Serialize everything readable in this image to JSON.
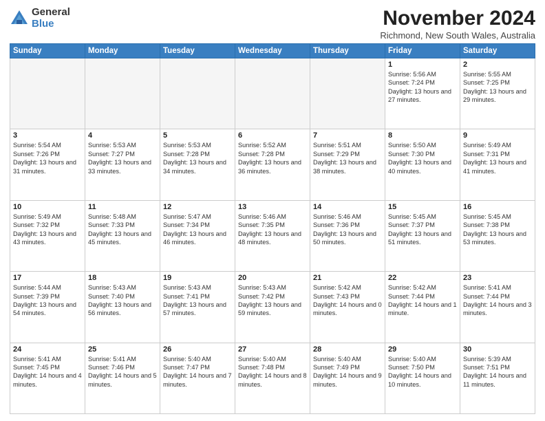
{
  "logo": {
    "general": "General",
    "blue": "Blue"
  },
  "title": "November 2024",
  "location": "Richmond, New South Wales, Australia",
  "days_of_week": [
    "Sunday",
    "Monday",
    "Tuesday",
    "Wednesday",
    "Thursday",
    "Friday",
    "Saturday"
  ],
  "weeks": [
    [
      {
        "date": "",
        "info": ""
      },
      {
        "date": "",
        "info": ""
      },
      {
        "date": "",
        "info": ""
      },
      {
        "date": "",
        "info": ""
      },
      {
        "date": "",
        "info": ""
      },
      {
        "date": "1",
        "info": "Sunrise: 5:56 AM\nSunset: 7:24 PM\nDaylight: 13 hours\nand 27 minutes."
      },
      {
        "date": "2",
        "info": "Sunrise: 5:55 AM\nSunset: 7:25 PM\nDaylight: 13 hours\nand 29 minutes."
      }
    ],
    [
      {
        "date": "3",
        "info": "Sunrise: 5:54 AM\nSunset: 7:26 PM\nDaylight: 13 hours\nand 31 minutes."
      },
      {
        "date": "4",
        "info": "Sunrise: 5:53 AM\nSunset: 7:27 PM\nDaylight: 13 hours\nand 33 minutes."
      },
      {
        "date": "5",
        "info": "Sunrise: 5:53 AM\nSunset: 7:28 PM\nDaylight: 13 hours\nand 34 minutes."
      },
      {
        "date": "6",
        "info": "Sunrise: 5:52 AM\nSunset: 7:28 PM\nDaylight: 13 hours\nand 36 minutes."
      },
      {
        "date": "7",
        "info": "Sunrise: 5:51 AM\nSunset: 7:29 PM\nDaylight: 13 hours\nand 38 minutes."
      },
      {
        "date": "8",
        "info": "Sunrise: 5:50 AM\nSunset: 7:30 PM\nDaylight: 13 hours\nand 40 minutes."
      },
      {
        "date": "9",
        "info": "Sunrise: 5:49 AM\nSunset: 7:31 PM\nDaylight: 13 hours\nand 41 minutes."
      }
    ],
    [
      {
        "date": "10",
        "info": "Sunrise: 5:49 AM\nSunset: 7:32 PM\nDaylight: 13 hours\nand 43 minutes."
      },
      {
        "date": "11",
        "info": "Sunrise: 5:48 AM\nSunset: 7:33 PM\nDaylight: 13 hours\nand 45 minutes."
      },
      {
        "date": "12",
        "info": "Sunrise: 5:47 AM\nSunset: 7:34 PM\nDaylight: 13 hours\nand 46 minutes."
      },
      {
        "date": "13",
        "info": "Sunrise: 5:46 AM\nSunset: 7:35 PM\nDaylight: 13 hours\nand 48 minutes."
      },
      {
        "date": "14",
        "info": "Sunrise: 5:46 AM\nSunset: 7:36 PM\nDaylight: 13 hours\nand 50 minutes."
      },
      {
        "date": "15",
        "info": "Sunrise: 5:45 AM\nSunset: 7:37 PM\nDaylight: 13 hours\nand 51 minutes."
      },
      {
        "date": "16",
        "info": "Sunrise: 5:45 AM\nSunset: 7:38 PM\nDaylight: 13 hours\nand 53 minutes."
      }
    ],
    [
      {
        "date": "17",
        "info": "Sunrise: 5:44 AM\nSunset: 7:39 PM\nDaylight: 13 hours\nand 54 minutes."
      },
      {
        "date": "18",
        "info": "Sunrise: 5:43 AM\nSunset: 7:40 PM\nDaylight: 13 hours\nand 56 minutes."
      },
      {
        "date": "19",
        "info": "Sunrise: 5:43 AM\nSunset: 7:41 PM\nDaylight: 13 hours\nand 57 minutes."
      },
      {
        "date": "20",
        "info": "Sunrise: 5:43 AM\nSunset: 7:42 PM\nDaylight: 13 hours\nand 59 minutes."
      },
      {
        "date": "21",
        "info": "Sunrise: 5:42 AM\nSunset: 7:43 PM\nDaylight: 14 hours\nand 0 minutes."
      },
      {
        "date": "22",
        "info": "Sunrise: 5:42 AM\nSunset: 7:44 PM\nDaylight: 14 hours\nand 1 minute."
      },
      {
        "date": "23",
        "info": "Sunrise: 5:41 AM\nSunset: 7:44 PM\nDaylight: 14 hours\nand 3 minutes."
      }
    ],
    [
      {
        "date": "24",
        "info": "Sunrise: 5:41 AM\nSunset: 7:45 PM\nDaylight: 14 hours\nand 4 minutes."
      },
      {
        "date": "25",
        "info": "Sunrise: 5:41 AM\nSunset: 7:46 PM\nDaylight: 14 hours\nand 5 minutes."
      },
      {
        "date": "26",
        "info": "Sunrise: 5:40 AM\nSunset: 7:47 PM\nDaylight: 14 hours\nand 7 minutes."
      },
      {
        "date": "27",
        "info": "Sunrise: 5:40 AM\nSunset: 7:48 PM\nDaylight: 14 hours\nand 8 minutes."
      },
      {
        "date": "28",
        "info": "Sunrise: 5:40 AM\nSunset: 7:49 PM\nDaylight: 14 hours\nand 9 minutes."
      },
      {
        "date": "29",
        "info": "Sunrise: 5:40 AM\nSunset: 7:50 PM\nDaylight: 14 hours\nand 10 minutes."
      },
      {
        "date": "30",
        "info": "Sunrise: 5:39 AM\nSunset: 7:51 PM\nDaylight: 14 hours\nand 11 minutes."
      }
    ]
  ]
}
